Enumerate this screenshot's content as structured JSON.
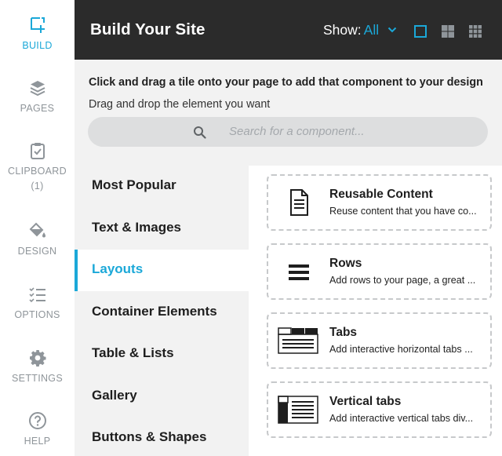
{
  "colors": {
    "accent": "#1ba8d8",
    "header_bg": "#2b2b2b",
    "panel_bg": "#f2f2f2",
    "rail_text": "#8f959a"
  },
  "rail": {
    "items": [
      {
        "label": "BUILD",
        "icon": "build-icon",
        "active": true
      },
      {
        "label": "PAGES",
        "icon": "layers-icon"
      },
      {
        "label": "CLIPBOARD",
        "sub": "(1)",
        "icon": "clipboard-icon"
      },
      {
        "label": "DESIGN",
        "icon": "paint-bucket-icon"
      },
      {
        "label": "OPTIONS",
        "icon": "checklist-icon"
      },
      {
        "label": "SETTINGS",
        "icon": "gear-icon"
      },
      {
        "label": "HELP",
        "icon": "help-icon"
      }
    ]
  },
  "header": {
    "title": "Build Your Site",
    "show_label": "Show:",
    "show_value": "All"
  },
  "intro": {
    "title": "Click and drag a tile onto your page to add that component to your design",
    "subtitle": "Drag and drop the element you want"
  },
  "search": {
    "placeholder": "Search for a component..."
  },
  "categories": [
    {
      "label": "Most Popular"
    },
    {
      "label": "Text & Images"
    },
    {
      "label": "Layouts",
      "active": true
    },
    {
      "label": "Container Elements"
    },
    {
      "label": "Table & Lists"
    },
    {
      "label": "Gallery"
    },
    {
      "label": "Buttons & Shapes"
    }
  ],
  "tiles": [
    {
      "title": "Reusable Content",
      "desc": "Reuse content that you have co...",
      "icon": "document-icon"
    },
    {
      "title": "Rows",
      "desc": "Add rows to your page, a great ...",
      "icon": "rows-icon"
    },
    {
      "title": "Tabs",
      "desc": "Add interactive horizontal tabs ...",
      "icon": "horizontal-tabs-icon"
    },
    {
      "title": "Vertical tabs",
      "desc": "Add interactive vertical tabs div...",
      "icon": "vertical-tabs-icon"
    }
  ]
}
